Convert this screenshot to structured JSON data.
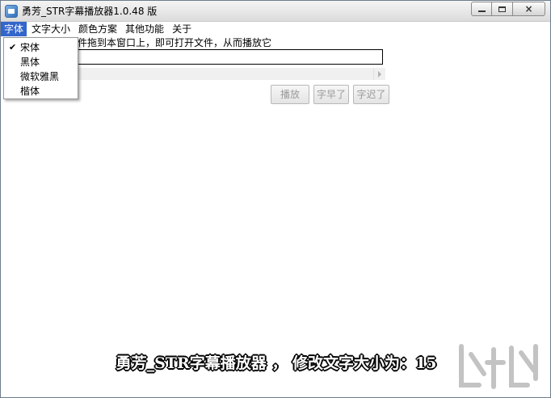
{
  "window": {
    "title": "勇芳_STR字幕播放器1.0.48 版",
    "close_glyph": "×"
  },
  "menubar": {
    "items": [
      {
        "label": "字体"
      },
      {
        "label": "文字大小"
      },
      {
        "label": "颜色方案"
      },
      {
        "label": "其他功能"
      },
      {
        "label": "关于"
      }
    ]
  },
  "font_menu": {
    "check_glyph": "✔",
    "selected": "宋体",
    "items": [
      {
        "label": "宋体"
      },
      {
        "label": "黑体"
      },
      {
        "label": "微软雅黑"
      },
      {
        "label": "楷体"
      }
    ]
  },
  "main": {
    "hint_text": "件拖到本窗口上，即可打开文件，从而播放它",
    "file_path_value": "",
    "buttons": {
      "play_label": "播放",
      "early_label": "字早了",
      "late_label": "字迟了"
    }
  },
  "subtitle": {
    "text": "勇芳_STR字幕播放器 ， 修改文字大小为：15"
  },
  "colors": {
    "menu_highlight": "#3366cc",
    "subtitle_fill": "#ffffff",
    "subtitle_outline": "#000000"
  }
}
